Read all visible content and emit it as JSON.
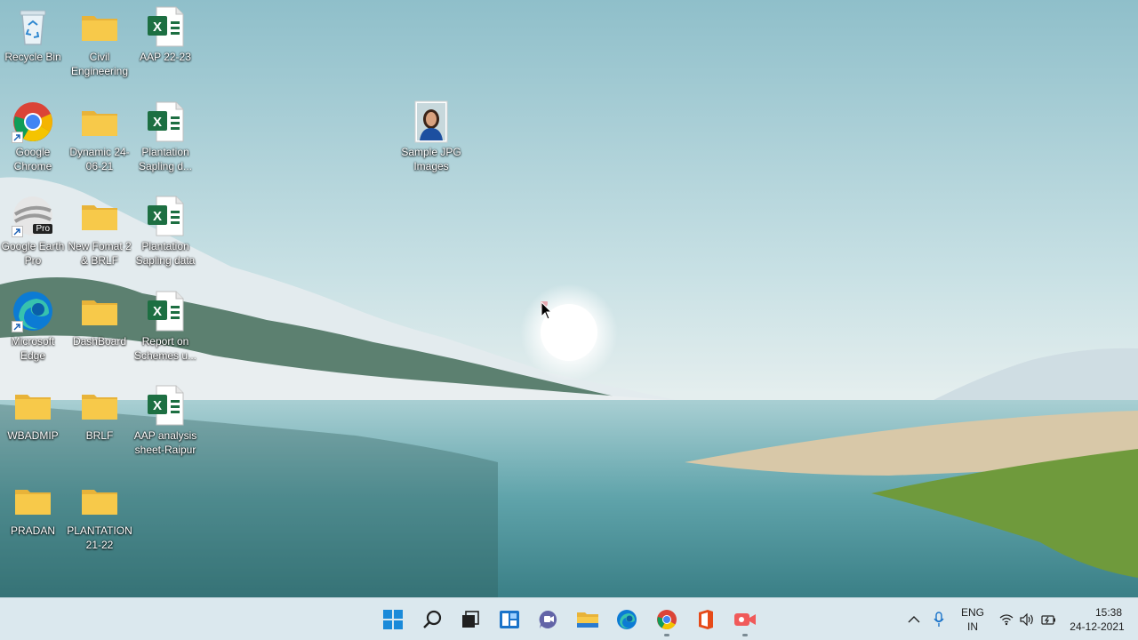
{
  "desktop": {
    "icons": [
      {
        "label": "Recycle Bin",
        "icon": "recycle-bin-icon"
      },
      {
        "label": "Civil Engineering",
        "icon": "folder-icon"
      },
      {
        "label": "AAP 22-23",
        "icon": "excel-file-icon"
      },
      {
        "label": "Google Chrome",
        "icon": "chrome-icon"
      },
      {
        "label": "Dynamic 24-06-21",
        "icon": "folder-icon"
      },
      {
        "label": "Plantation Sapling d...",
        "icon": "excel-file-icon"
      },
      {
        "label": "Sample JPG Images",
        "icon": "image-file-icon"
      },
      {
        "label": "Google Earth Pro",
        "icon": "google-earth-pro-icon",
        "badge": "Pro"
      },
      {
        "label": "New Fomat 2 & BRLF",
        "icon": "folder-icon"
      },
      {
        "label": "Plantation Sapling data",
        "icon": "excel-file-icon"
      },
      {
        "label": "Microsoft Edge",
        "icon": "edge-icon"
      },
      {
        "label": "DashBoard",
        "icon": "folder-icon"
      },
      {
        "label": "Report on Schemes u...",
        "icon": "excel-file-icon"
      },
      {
        "label": "WBADMIP",
        "icon": "folder-icon"
      },
      {
        "label": "BRLF",
        "icon": "folder-icon"
      },
      {
        "label": "AAP analysis sheet-Raipur",
        "icon": "excel-file-icon"
      },
      {
        "label": "PRADAN",
        "icon": "folder-icon"
      },
      {
        "label": "PLANTATION 21-22",
        "icon": "folder-icon"
      }
    ]
  },
  "taskbar": {
    "apps": [
      "start-icon",
      "search-icon",
      "task-view-icon",
      "widgets-icon",
      "teams-chat-icon",
      "file-explorer-icon",
      "edge-icon",
      "chrome-icon",
      "office-icon",
      "screen-recorder-icon"
    ],
    "tray": {
      "language": "ENG",
      "region": "IN",
      "time": "15:38",
      "date": "24-12-2021"
    }
  },
  "colors": {
    "folder": "#f7c94a",
    "excel": "#1d6f42",
    "taskbar": "#dbe8ee"
  }
}
